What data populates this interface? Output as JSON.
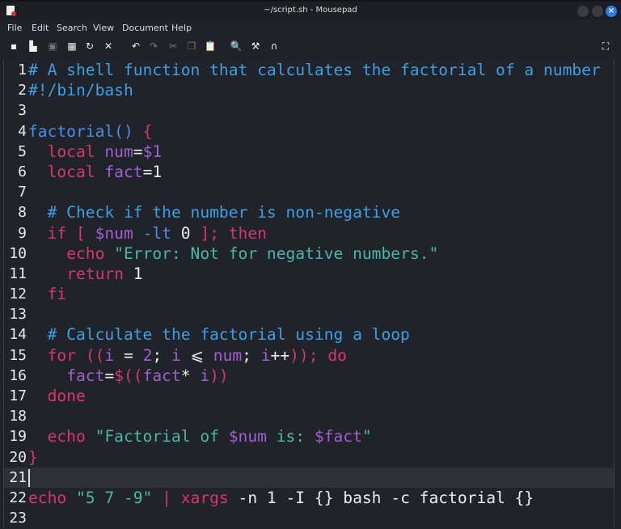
{
  "window": {
    "title": "~/script.sh - Mousepad"
  },
  "menu": [
    "File",
    "Edit",
    "Search",
    "View",
    "Document",
    "Help"
  ],
  "toolbar": [
    {
      "icon": "new-document-icon",
      "glyph": "▪"
    },
    {
      "icon": "new-window-icon",
      "glyph": "▙"
    },
    {
      "icon": "save-icon",
      "glyph": "▣",
      "dim": true
    },
    {
      "icon": "save-as-icon",
      "glyph": "▦"
    },
    {
      "icon": "reload-icon",
      "glyph": "↻"
    },
    {
      "icon": "close-icon",
      "glyph": "✕"
    },
    {
      "icon": "undo-icon",
      "glyph": "↶"
    },
    {
      "icon": "redo-icon",
      "glyph": "↷",
      "dim": true
    },
    {
      "icon": "cut-icon",
      "glyph": "✂",
      "dim": true
    },
    {
      "icon": "copy-icon",
      "glyph": "❐",
      "dim": true
    },
    {
      "icon": "paste-icon",
      "glyph": "📋"
    },
    {
      "icon": "find-icon",
      "glyph": "🔍"
    },
    {
      "icon": "find-replace-icon",
      "glyph": "⚒"
    },
    {
      "icon": "go-to-line-icon",
      "glyph": "∩"
    }
  ],
  "fullscreen_icon": "⛶",
  "colors": {
    "keyword": "#d6386a",
    "variable": "#a35fcf",
    "comment": "#3f9fe3",
    "string": "#4bb8a3",
    "function": "#4b8fe6"
  },
  "current_line": 21,
  "lines": [
    {
      "n": "1",
      "tokens": [
        [
          "cm",
          "# A shell function that calculates the factorial of a number"
        ]
      ]
    },
    {
      "n": "2",
      "tokens": [
        [
          "cm",
          "#!/bin/bash"
        ]
      ]
    },
    {
      "n": "3",
      "tokens": []
    },
    {
      "n": "4",
      "tokens": [
        [
          "fn",
          "factorial()"
        ],
        [
          "pl",
          " "
        ],
        [
          "kw",
          "{"
        ]
      ]
    },
    {
      "n": "5",
      "tokens": [
        [
          "pl",
          "  "
        ],
        [
          "kw",
          "local"
        ],
        [
          "pl",
          " "
        ],
        [
          "var",
          "num"
        ],
        [
          "pl",
          "="
        ],
        [
          "var",
          "$1"
        ]
      ]
    },
    {
      "n": "6",
      "tokens": [
        [
          "pl",
          "  "
        ],
        [
          "kw",
          "local"
        ],
        [
          "pl",
          " "
        ],
        [
          "var",
          "fact"
        ],
        [
          "pl",
          "=1"
        ]
      ]
    },
    {
      "n": "7",
      "tokens": []
    },
    {
      "n": "8",
      "tokens": [
        [
          "pl",
          "  "
        ],
        [
          "cm",
          "# Check if the number is non-negative"
        ]
      ]
    },
    {
      "n": "9",
      "tokens": [
        [
          "pl",
          "  "
        ],
        [
          "kw",
          "if ["
        ],
        [
          "pl",
          " "
        ],
        [
          "var",
          "$num"
        ],
        [
          "pl",
          " "
        ],
        [
          "fn",
          "-lt"
        ],
        [
          "pl",
          " 0 "
        ],
        [
          "kw",
          "]; then"
        ]
      ]
    },
    {
      "n": "10",
      "tokens": [
        [
          "pl",
          "    "
        ],
        [
          "kw",
          "echo"
        ],
        [
          "pl",
          " "
        ],
        [
          "str",
          "\"Error: Not for negative numbers.\""
        ]
      ]
    },
    {
      "n": "11",
      "tokens": [
        [
          "pl",
          "    "
        ],
        [
          "kw",
          "return"
        ],
        [
          "pl",
          " 1"
        ]
      ]
    },
    {
      "n": "12",
      "tokens": [
        [
          "pl",
          "  "
        ],
        [
          "kw",
          "fi"
        ]
      ]
    },
    {
      "n": "13",
      "tokens": []
    },
    {
      "n": "14",
      "tokens": [
        [
          "pl",
          "  "
        ],
        [
          "cm",
          "# Calculate the factorial using a loop"
        ]
      ]
    },
    {
      "n": "15",
      "tokens": [
        [
          "pl",
          "  "
        ],
        [
          "kw",
          "for (("
        ],
        [
          "var",
          "i"
        ],
        [
          "pl",
          " = "
        ],
        [
          "var",
          "2"
        ],
        [
          "pl",
          "; "
        ],
        [
          "var",
          "i"
        ],
        [
          "pl",
          " ⩽ "
        ],
        [
          "var",
          "num"
        ],
        [
          "pl",
          "; "
        ],
        [
          "var",
          "i"
        ],
        [
          "pl",
          "++"
        ],
        [
          "kw",
          "));"
        ],
        [
          "pl",
          " "
        ],
        [
          "kw",
          "do"
        ]
      ]
    },
    {
      "n": "16",
      "tokens": [
        [
          "pl",
          "    "
        ],
        [
          "var",
          "fact"
        ],
        [
          "pl",
          "="
        ],
        [
          "kw",
          "$(("
        ],
        [
          "var",
          "fact"
        ],
        [
          "pl",
          "* "
        ],
        [
          "var",
          "i"
        ],
        [
          "kw",
          "))"
        ]
      ]
    },
    {
      "n": "17",
      "tokens": [
        [
          "pl",
          "  "
        ],
        [
          "kw",
          "done"
        ]
      ]
    },
    {
      "n": "18",
      "tokens": []
    },
    {
      "n": "19",
      "tokens": [
        [
          "pl",
          "  "
        ],
        [
          "kw",
          "echo"
        ],
        [
          "pl",
          " "
        ],
        [
          "str",
          "\"Factorial of "
        ],
        [
          "var",
          "$num"
        ],
        [
          "str",
          " is: "
        ],
        [
          "var",
          "$fact"
        ],
        [
          "str",
          "\""
        ]
      ]
    },
    {
      "n": "20",
      "tokens": [
        [
          "kw",
          "}"
        ]
      ]
    },
    {
      "n": "21",
      "tokens": []
    },
    {
      "n": "22",
      "tokens": [
        [
          "kw",
          "echo"
        ],
        [
          "pl",
          " "
        ],
        [
          "str",
          "\"5 7 -9\""
        ],
        [
          "pl",
          " "
        ],
        [
          "kw",
          "|"
        ],
        [
          "pl",
          " "
        ],
        [
          "kw",
          "xargs"
        ],
        [
          "pl",
          " -n 1 -I {} bash -c factorial {}"
        ]
      ]
    },
    {
      "n": "23",
      "tokens": []
    }
  ]
}
